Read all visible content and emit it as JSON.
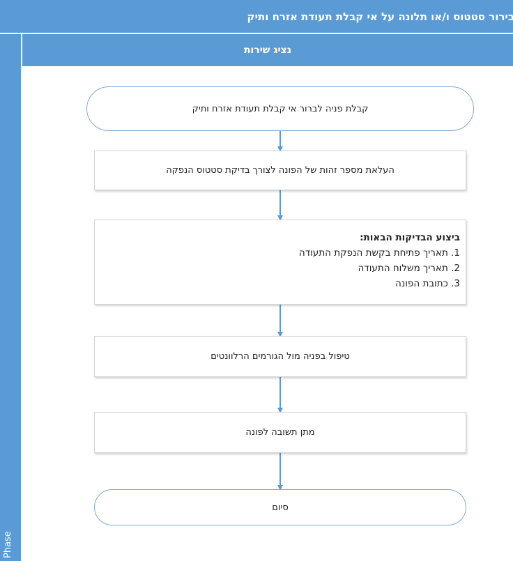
{
  "title": "בירור סטטוס ו/או תלונה על אי קבלת תעודת אזרח ותיק",
  "phase_label": "Phase",
  "lane_header": "נציג שירות",
  "steps": {
    "start": "קבלת פניה לברור אי קבלת תעודת אזרח ותיק",
    "upload_id": "העלאת מספר זהות של הפונה לצורך בדיקת סטטוס הנפקה",
    "checks_heading": "ביצוע הבדיקות הבאות:",
    "checks": [
      "1. תאריך פתיחת בקשת הנפקת התעודה",
      "2. תאריך משלוח התעודה",
      "3. כתובת הפונה"
    ],
    "handling": "טיפול בפניה מול הגורמים הרלוונטים",
    "reply": "מתן תשובה לפונה",
    "end": "סיום"
  },
  "colors": {
    "header_blue": "#5B9BD5",
    "arrow_blue": "#5B9BD5",
    "terminal_border": "#7FA7D4",
    "box_border": "#D4D4D4"
  }
}
